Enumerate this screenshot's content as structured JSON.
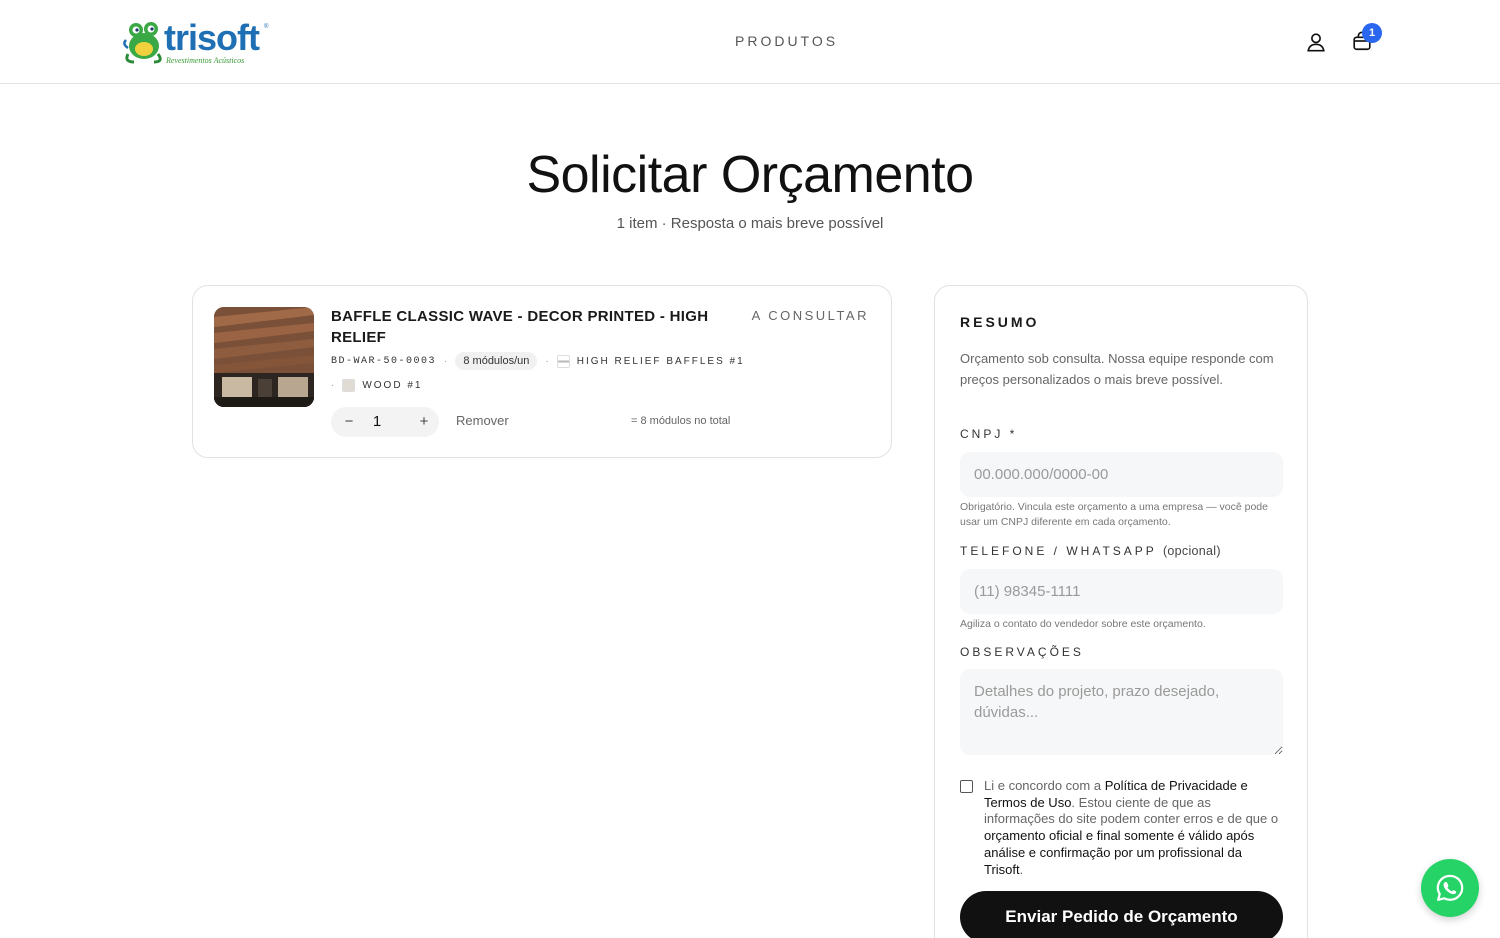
{
  "header": {
    "logo": {
      "brand": "trisoft",
      "tagline": "Revestimentos Acústicos",
      "registered": "®"
    },
    "nav": {
      "produtos": "PRODUTOS"
    },
    "icons": {
      "user": "user-icon",
      "cart": "shopping-bag-icon"
    },
    "cart_count": "1"
  },
  "page": {
    "title": "Solicitar Orçamento",
    "subtitle": "1 item · Resposta o mais breve possível"
  },
  "item": {
    "name": "BAFFLE CLASSIC WAVE - DECOR PRINTED - HIGH RELIEF",
    "price": "A CONSULTAR",
    "sku": "BD-WAR-50-0003",
    "modules_per_unit": "8 módulos/un",
    "separator": "·",
    "variant_model": "HIGH RELIEF BAFFLES #1",
    "variant_finish": "WOOD #1",
    "quantity": "1",
    "minus": "−",
    "plus": "+",
    "remove": "Remover",
    "total_modules": "= 8 módulos no total"
  },
  "summary": {
    "title": "RESUMO",
    "description": "Orçamento sob consulta. Nossa equipe responde com preços personalizados o mais breve possível.",
    "cnpj": {
      "label": "CNPJ *",
      "placeholder": "00.000.000/0000-00",
      "help": "Obrigatório. Vincula este orçamento a uma empresa — você pode usar um CNPJ diferente em cada orçamento."
    },
    "phone": {
      "label": "TELEFONE / WHATSAPP",
      "optional": "(opcional)",
      "placeholder": "(11) 98345-1111",
      "help": "Agiliza o contato do vendedor sobre este orçamento."
    },
    "notes": {
      "label": "OBSERVAÇÕES",
      "placeholder": "Detalhes do projeto, prazo desejado, dúvidas..."
    },
    "consent": {
      "part1": "Li e concordo com a ",
      "link": "Política de Privacidade e Termos de Uso",
      "part2": ". Estou ciente de que as informações do site podem conter erros e de que o ",
      "emphasis": "orçamento oficial e final somente é válido após análise e confirmação por um profissional da Trisoft",
      "part3": "."
    },
    "submit": "Enviar Pedido de Orçamento"
  },
  "floating": {
    "whatsapp_icon": "whatsapp-icon"
  },
  "colors": {
    "accent_blue": "#2b67ee",
    "whatsapp_green": "#25d366",
    "submit_bg": "#111111",
    "brand_blue": "#1f6fb5",
    "brand_green": "#3a9a35"
  }
}
